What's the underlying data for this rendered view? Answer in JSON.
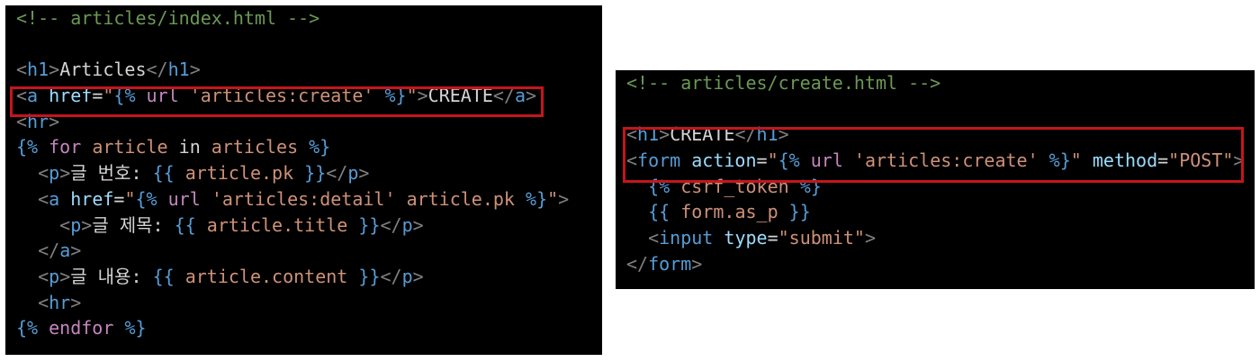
{
  "panels": [
    {
      "id": "left",
      "lines": [
        [
          [
            "comment",
            "<!-- articles/index.html -->"
          ]
        ],
        [],
        [
          [
            "punct",
            "<"
          ],
          [
            "tag",
            "h1"
          ],
          [
            "punct",
            ">"
          ],
          [
            "text",
            "Articles"
          ],
          [
            "punct",
            "</"
          ],
          [
            "tag",
            "h1"
          ],
          [
            "punct",
            ">"
          ]
        ],
        [
          [
            "punct",
            "<"
          ],
          [
            "tag",
            "a"
          ],
          [
            "ws",
            " "
          ],
          [
            "attr",
            "href"
          ],
          [
            "text",
            "="
          ],
          [
            "str",
            "\""
          ],
          [
            "tmpl",
            "{%"
          ],
          [
            "ws",
            " "
          ],
          [
            "kw",
            "url"
          ],
          [
            "ws",
            " "
          ],
          [
            "str",
            "'articles:create'"
          ],
          [
            "ws",
            " "
          ],
          [
            "tmpl",
            "%}"
          ],
          [
            "str",
            "\""
          ],
          [
            "punct",
            ">"
          ],
          [
            "text",
            "CREATE"
          ],
          [
            "punct",
            "</"
          ],
          [
            "tag",
            "a"
          ],
          [
            "punct",
            ">"
          ]
        ],
        [
          [
            "punct",
            "<"
          ],
          [
            "tag",
            "hr"
          ],
          [
            "punct",
            ">"
          ]
        ],
        [
          [
            "tmpl",
            "{%"
          ],
          [
            "ws",
            " "
          ],
          [
            "kw",
            "for"
          ],
          [
            "ws",
            " "
          ],
          [
            "str",
            "article"
          ],
          [
            "ws",
            " "
          ],
          [
            "text",
            "in"
          ],
          [
            "ws",
            " "
          ],
          [
            "str",
            "articles"
          ],
          [
            "ws",
            " "
          ],
          [
            "tmpl",
            "%}"
          ]
        ],
        [
          [
            "ws",
            "  "
          ],
          [
            "punct",
            "<"
          ],
          [
            "tag",
            "p"
          ],
          [
            "punct",
            ">"
          ],
          [
            "text",
            "글 번호: "
          ],
          [
            "tmpl",
            "{{"
          ],
          [
            "ws",
            " "
          ],
          [
            "str",
            "article.pk"
          ],
          [
            "ws",
            " "
          ],
          [
            "tmpl",
            "}}"
          ],
          [
            "punct",
            "</"
          ],
          [
            "tag",
            "p"
          ],
          [
            "punct",
            ">"
          ]
        ],
        [
          [
            "ws",
            "  "
          ],
          [
            "punct",
            "<"
          ],
          [
            "tag",
            "a"
          ],
          [
            "ws",
            " "
          ],
          [
            "attr",
            "href"
          ],
          [
            "text",
            "="
          ],
          [
            "str",
            "\""
          ],
          [
            "tmpl",
            "{%"
          ],
          [
            "ws",
            " "
          ],
          [
            "kw",
            "url"
          ],
          [
            "ws",
            " "
          ],
          [
            "str",
            "'articles:detail'"
          ],
          [
            "ws",
            " "
          ],
          [
            "str",
            "article.pk"
          ],
          [
            "ws",
            " "
          ],
          [
            "tmpl",
            "%}"
          ],
          [
            "str",
            "\""
          ],
          [
            "punct",
            ">"
          ]
        ],
        [
          [
            "ws",
            "    "
          ],
          [
            "punct",
            "<"
          ],
          [
            "tag",
            "p"
          ],
          [
            "punct",
            ">"
          ],
          [
            "text",
            "글 제목: "
          ],
          [
            "tmpl",
            "{{"
          ],
          [
            "ws",
            " "
          ],
          [
            "str",
            "article.title"
          ],
          [
            "ws",
            " "
          ],
          [
            "tmpl",
            "}}"
          ],
          [
            "punct",
            "</"
          ],
          [
            "tag",
            "p"
          ],
          [
            "punct",
            ">"
          ]
        ],
        [
          [
            "ws",
            "  "
          ],
          [
            "punct",
            "</"
          ],
          [
            "tag",
            "a"
          ],
          [
            "punct",
            ">"
          ]
        ],
        [
          [
            "ws",
            "  "
          ],
          [
            "punct",
            "<"
          ],
          [
            "tag",
            "p"
          ],
          [
            "punct",
            ">"
          ],
          [
            "text",
            "글 내용: "
          ],
          [
            "tmpl",
            "{{"
          ],
          [
            "ws",
            " "
          ],
          [
            "str",
            "article.content"
          ],
          [
            "ws",
            " "
          ],
          [
            "tmpl",
            "}}"
          ],
          [
            "punct",
            "</"
          ],
          [
            "tag",
            "p"
          ],
          [
            "punct",
            ">"
          ]
        ],
        [
          [
            "ws",
            "  "
          ],
          [
            "punct",
            "<"
          ],
          [
            "tag",
            "hr"
          ],
          [
            "punct",
            ">"
          ]
        ],
        [
          [
            "tmpl",
            "{%"
          ],
          [
            "ws",
            " "
          ],
          [
            "kw",
            "endfor"
          ],
          [
            "ws",
            " "
          ],
          [
            "tmpl",
            "%}"
          ]
        ]
      ]
    },
    {
      "id": "right",
      "lines": [
        [
          [
            "comment",
            "<!-- articles/create.html -->"
          ]
        ],
        [],
        [
          [
            "punct",
            "<"
          ],
          [
            "tag",
            "h1"
          ],
          [
            "punct",
            ">"
          ],
          [
            "text",
            "CREATE"
          ],
          [
            "punct",
            "</"
          ],
          [
            "tag",
            "h1"
          ],
          [
            "punct",
            ">"
          ]
        ],
        [
          [
            "punct",
            "<"
          ],
          [
            "tag",
            "form"
          ],
          [
            "ws",
            " "
          ],
          [
            "attr",
            "action"
          ],
          [
            "text",
            "="
          ],
          [
            "str",
            "\""
          ],
          [
            "tmpl",
            "{%"
          ],
          [
            "ws",
            " "
          ],
          [
            "kw",
            "url"
          ],
          [
            "ws",
            " "
          ],
          [
            "str",
            "'articles:create'"
          ],
          [
            "ws",
            " "
          ],
          [
            "tmpl",
            "%}"
          ],
          [
            "str",
            "\""
          ],
          [
            "ws",
            " "
          ],
          [
            "attr",
            "method"
          ],
          [
            "text",
            "="
          ],
          [
            "str",
            "\"POST\""
          ],
          [
            "punct",
            ">"
          ]
        ],
        [
          [
            "ws",
            "  "
          ],
          [
            "tmpl",
            "{%"
          ],
          [
            "ws",
            " "
          ],
          [
            "str",
            "csrf_token"
          ],
          [
            "ws",
            " "
          ],
          [
            "tmpl",
            "%}"
          ]
        ],
        [
          [
            "ws",
            "  "
          ],
          [
            "tmpl",
            "{{"
          ],
          [
            "ws",
            " "
          ],
          [
            "str",
            "form.as_p"
          ],
          [
            "ws",
            " "
          ],
          [
            "tmpl",
            "}}"
          ]
        ],
        [
          [
            "ws",
            "  "
          ],
          [
            "punct",
            "<"
          ],
          [
            "tag",
            "input"
          ],
          [
            "ws",
            " "
          ],
          [
            "attr",
            "type"
          ],
          [
            "text",
            "="
          ],
          [
            "str",
            "\"submit\""
          ],
          [
            "punct",
            ">"
          ]
        ],
        [
          [
            "punct",
            "</"
          ],
          [
            "tag",
            "form"
          ],
          [
            "punct",
            ">"
          ]
        ]
      ]
    }
  ],
  "colors": {
    "background": "#000000",
    "highlight_border": "#c4161c",
    "comment": "#6a9955",
    "tag": "#569cd6",
    "attribute": "#9cdcfe",
    "string": "#ce9178",
    "keyword": "#c586c0",
    "text": "#d4d4d4",
    "punctuation": "#808080"
  }
}
